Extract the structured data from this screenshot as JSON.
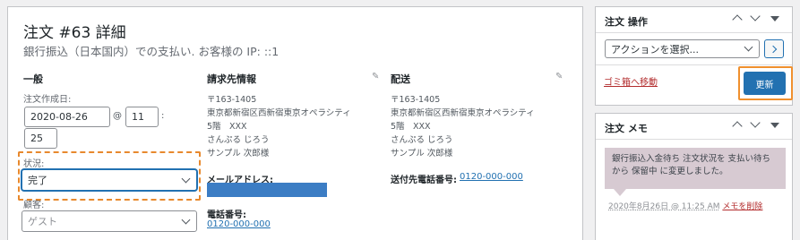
{
  "order": {
    "title": "注文 #63 詳細",
    "subtitle": "銀行振込（日本国内）での支払い. お客様の IP: ::1"
  },
  "general": {
    "heading": "一般",
    "created_label": "注文作成日:",
    "date_value": "2020-08-26",
    "at_symbol": "@",
    "hour_value": "11",
    "colon": ":",
    "minute_value": "25",
    "status_label": "状況:",
    "status_value": "完了",
    "customer_label": "顧客:",
    "customer_value": "ゲスト"
  },
  "billing": {
    "heading": "請求先情報",
    "address_lines": [
      "〒163-1405",
      "東京都新宿区西新宿東京オペラシティ",
      "5階　XXX",
      "さんぷる じろう",
      "サンプル 次郎様"
    ],
    "email_label": "メールアドレス:",
    "phone_label": "電話番号:",
    "phone_value": "0120-000-000"
  },
  "shipping": {
    "heading": "配送",
    "address_lines": [
      "〒163-1405",
      "東京都新宿区西新宿東京オペラシティ",
      "5階　XXX",
      "さんぷる じろう",
      "サンプル 次郎様"
    ],
    "phone_label": "送付先電話番号:",
    "phone_value": "0120-000-000"
  },
  "actions_box": {
    "title": "注文 操作",
    "select_placeholder": "アクションを選択...",
    "trash_link": "ゴミ箱へ移動",
    "update_button": "更新"
  },
  "notes_box": {
    "title": "注文 メモ",
    "note_text": "銀行振込入金待ち 注文状況を 支払い待ち から 保留中 に変更しました。",
    "note_date": "2020年8月26日 @ 11:25 AM",
    "delete_link": "メモを削除"
  },
  "colors": {
    "accent": "#2271b1",
    "highlight": "#e8892d",
    "danger": "#b32d2e",
    "note_bg": "#d7cad2"
  }
}
